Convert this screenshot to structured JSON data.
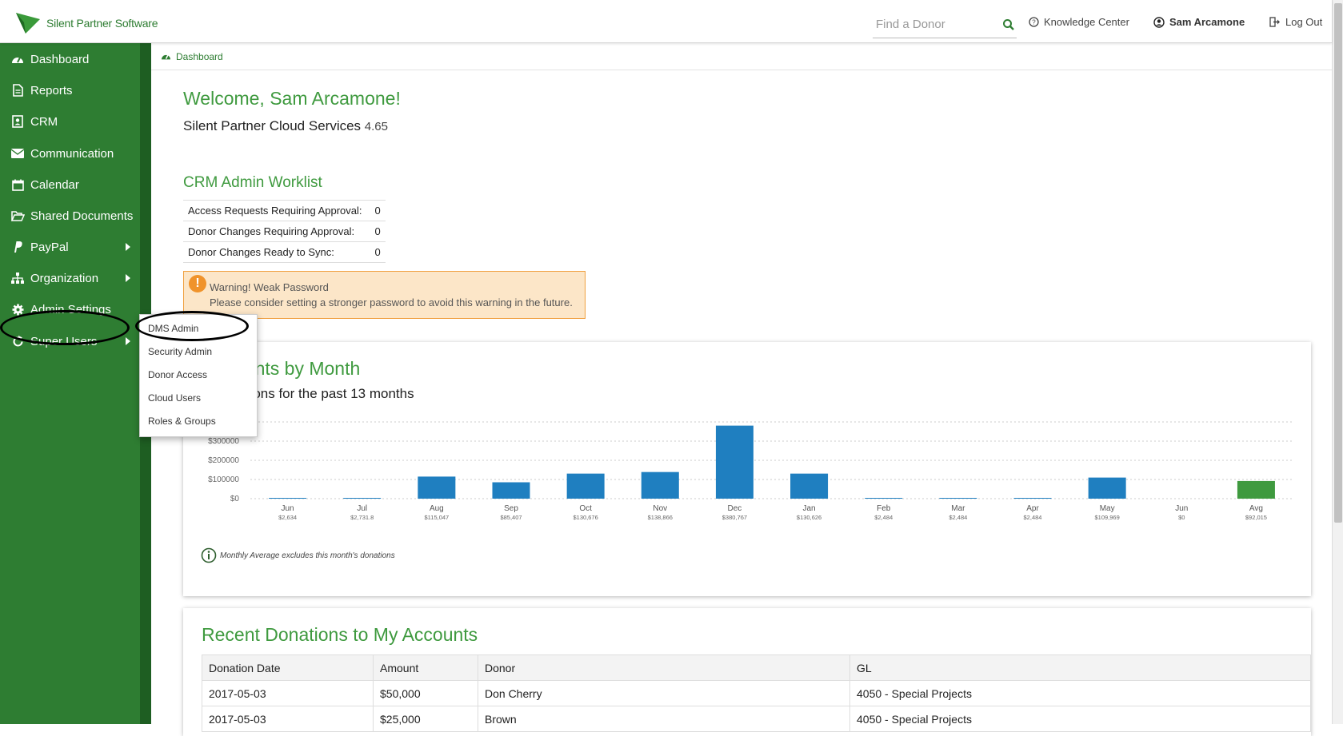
{
  "header": {
    "brand": "Silent Partner Software",
    "search_placeholder": "Find a Donor",
    "knowledge_center": "Knowledge Center",
    "user_name": "Sam Arcamone",
    "logout": "Log Out"
  },
  "sidebar": {
    "items": [
      {
        "label": "Dashboard",
        "icon": "dashboard-icon"
      },
      {
        "label": "Reports",
        "icon": "document-icon"
      },
      {
        "label": "CRM",
        "icon": "contact-card-icon"
      },
      {
        "label": "Communication",
        "icon": "envelope-icon"
      },
      {
        "label": "Calendar",
        "icon": "calendar-icon"
      },
      {
        "label": "Shared Documents",
        "icon": "folder-open-icon"
      },
      {
        "label": "PayPal",
        "icon": "paypal-icon"
      },
      {
        "label": "Organization",
        "icon": "sitemap-icon"
      },
      {
        "label": "Admin Settings",
        "icon": "gear-icon"
      },
      {
        "label": "Super Users",
        "icon": "refresh-icon"
      }
    ]
  },
  "admin_menu": {
    "items": [
      "DMS Admin",
      "Security Admin",
      "Donor Access",
      "Cloud Users",
      "Roles & Groups"
    ]
  },
  "breadcrumb": {
    "label": "Dashboard"
  },
  "welcome": {
    "title": "Welcome, Sam Arcamone!",
    "product": "Silent Partner Cloud Services",
    "version": "4.65"
  },
  "worklist": {
    "title": "CRM Admin Worklist",
    "rows": [
      {
        "label": "Access Requests Requiring Approval:",
        "value": "0"
      },
      {
        "label": "Donor Changes Requiring Approval:",
        "value": "0"
      },
      {
        "label": "Donor Changes Ready to Sync:",
        "value": "0"
      }
    ]
  },
  "warning": {
    "title": "Warning! Weak Password",
    "text": "Please consider setting a stronger password to avoid this warning in the future."
  },
  "chart_panel": {
    "title_visible": "ccounts by Month",
    "subtitle_visible": "donations for the past 13 months",
    "note": "Monthly Average excludes this month's donations"
  },
  "chart_data": {
    "type": "bar",
    "categories": [
      "Jun",
      "Jul",
      "Aug",
      "Sep",
      "Oct",
      "Nov",
      "Dec",
      "Jan",
      "Feb",
      "Mar",
      "Apr",
      "May",
      "Jun",
      "Avg"
    ],
    "value_labels": [
      "$2,634",
      "$2,731.8",
      "$115,047",
      "$85,407",
      "$130,676",
      "$138,866",
      "$380,767",
      "$130,626",
      "$2,484",
      "$2,484",
      "$2,484",
      "$109,969",
      "$0",
      "$92,015"
    ],
    "values": [
      2634,
      2731.8,
      115047,
      85407,
      130676,
      138866,
      380767,
      130626,
      2484,
      2484,
      2484,
      109969,
      0,
      92015
    ],
    "y_ticks": [
      "$0",
      "$100000",
      "$200000",
      "$300000"
    ],
    "ylim": [
      0,
      400000
    ],
    "colors": {
      "bar": "#1f7fc0",
      "avg": "#3f9a3f"
    },
    "grid": true
  },
  "recent": {
    "title": "Recent Donations to My Accounts",
    "columns": [
      "Donation Date",
      "Amount",
      "Donor",
      "GL"
    ],
    "rows": [
      [
        "2017-05-03",
        "$50,000",
        "Don Cherry",
        "4050 - Special Projects"
      ],
      [
        "2017-05-03",
        "$25,000",
        "Brown",
        "4050 - Special Projects"
      ]
    ]
  },
  "colors": {
    "brand_green": "#2e7d32",
    "heading_green": "#3f9a3f",
    "warning_bg": "#fce6c8"
  }
}
